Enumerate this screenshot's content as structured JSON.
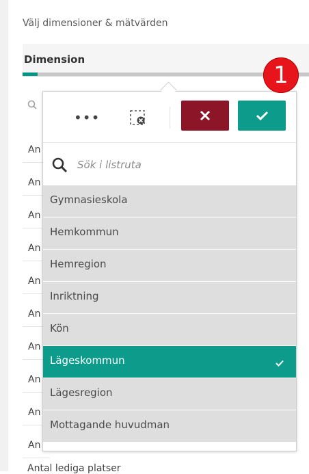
{
  "panel": {
    "heading": "Välj dimensioner & mätvärden",
    "dimension_title": "Dimension"
  },
  "badge": {
    "number": "1"
  },
  "background_list": {
    "rows": [
      "An",
      "An",
      "An",
      "An",
      "An",
      "An",
      "An",
      "An",
      "An",
      "An"
    ],
    "bottom_text": "Antal lediga platser"
  },
  "popover": {
    "search": {
      "placeholder": "Sök i listruta",
      "value": ""
    },
    "items": [
      {
        "label": "Gymnasieskola",
        "selected": false
      },
      {
        "label": "Hemkommun",
        "selected": false
      },
      {
        "label": "Hemregion",
        "selected": false
      },
      {
        "label": "Inriktning",
        "selected": false
      },
      {
        "label": "Kön",
        "selected": false
      },
      {
        "label": "Lägeskommun",
        "selected": true
      },
      {
        "label": "Lägesregion",
        "selected": false
      },
      {
        "label": "Mottagande huvudman",
        "selected": false
      }
    ]
  },
  "colors": {
    "accent": "#0d9c8c",
    "cancel": "#8c1528",
    "badge": "#e8141b",
    "item_bg": "#dedede"
  },
  "icons": {
    "more": "more-icon",
    "clear_selection": "clear-selection-icon",
    "cancel": "close-icon",
    "confirm": "check-icon",
    "search": "search-icon",
    "selected_item": "check-icon"
  }
}
